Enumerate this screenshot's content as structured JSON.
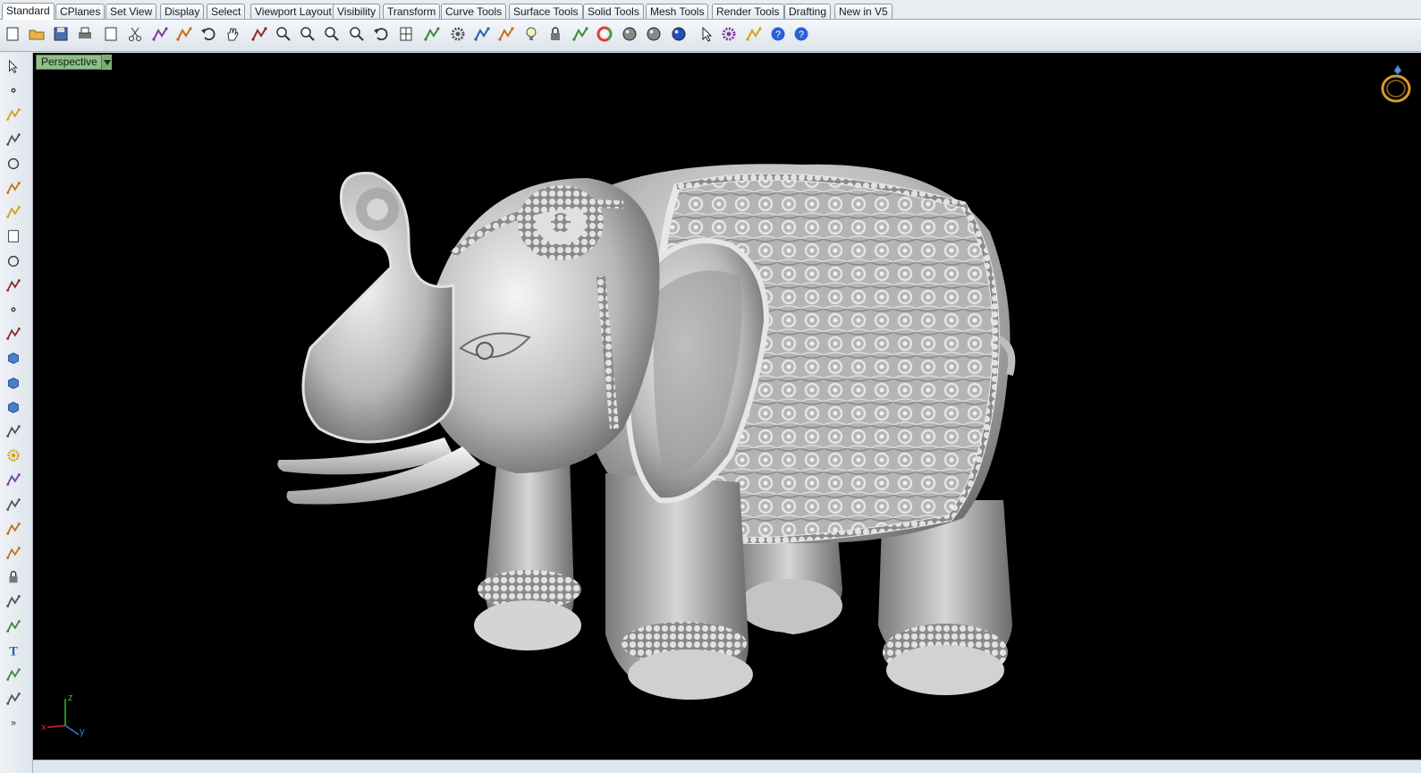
{
  "tabs": [
    {
      "label": "Standard",
      "active": true
    },
    {
      "label": "CPlanes"
    },
    {
      "label": "Set View"
    },
    {
      "label": "Display"
    },
    {
      "label": "Select"
    },
    {
      "label": "Viewport Layout"
    },
    {
      "label": "Visibility"
    },
    {
      "label": "Transform"
    },
    {
      "label": "Curve Tools"
    },
    {
      "label": "Surface Tools"
    },
    {
      "label": "Solid Tools"
    },
    {
      "label": "Mesh Tools"
    },
    {
      "label": "Render Tools"
    },
    {
      "label": "Drafting"
    },
    {
      "label": "New in V5"
    }
  ],
  "toolbar": {
    "icons": [
      "new-file-icon",
      "open-folder-icon",
      "save-icon",
      "print-icon",
      "import-icon",
      "cut-icon",
      "copy-icon",
      "paste-icon",
      "undo-icon",
      "pan-hand-icon",
      "rotate-view-icon",
      "zoom-icon",
      "zoom-window-icon",
      "zoom-extents-icon",
      "zoom-selected-icon",
      "undo-view-icon",
      "four-viewports-icon",
      "car-icon",
      "options-icon",
      "cplane-icon",
      "snap-icon",
      "light-bulb-icon",
      "lock-icon",
      "layer-icon",
      "color-wheel-icon",
      "shaded-sphere-icon",
      "rendered-sphere-icon",
      "render-blue-sphere-icon",
      "select-filter-icon",
      "settings-gear-icon",
      "dimension-icon",
      "help-icon",
      "tool-help-icon"
    ]
  },
  "left_toolbar": {
    "icons": [
      "select-arrow-icon",
      "point-icon",
      "polyline-icon",
      "curve-icon",
      "circle-icon",
      "ellipse-icon",
      "polygon-icon",
      "rectangle-icon",
      "circle-from-center-icon",
      "fillet-curve-icon",
      "surface-from-points-icon",
      "extrude-surface-icon",
      "box-solid-icon",
      "boolean-union-icon",
      "cylinder-icon",
      "plane-surface-icon",
      "transform-gear-icon",
      "analyze-icon",
      "dimension-tool-icon",
      "align-icon",
      "group-icon",
      "block-icon",
      "curve-from-object-icon",
      "offset-icon",
      "text-icon",
      "scale-icon",
      "array-icon",
      "more-chevron-icon"
    ]
  },
  "viewport": {
    "title": "Perspective",
    "axis": {
      "x": "x",
      "y": "y",
      "z": "z"
    },
    "background": "#000000",
    "model_description_color": "#c8c8c8"
  },
  "colors": {
    "viewport_title_bg": "#8fbf8a",
    "axis_x": "#d32f2f",
    "axis_y": "#2f7fd3",
    "axis_z": "#2fbf2f"
  }
}
